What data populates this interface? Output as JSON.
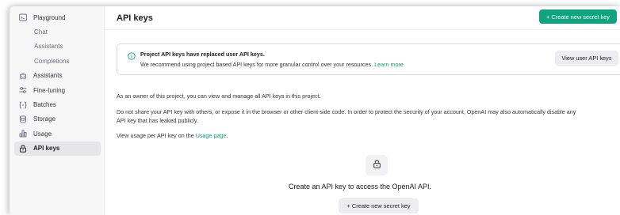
{
  "sidebar": {
    "items": [
      {
        "label": "Playground",
        "icon": "terminal-icon",
        "sub": false,
        "active": false
      },
      {
        "label": "Chat",
        "sub": true,
        "active": false
      },
      {
        "label": "Assistants",
        "sub": true,
        "active": false
      },
      {
        "label": "Completions",
        "sub": true,
        "active": false
      },
      {
        "label": "Assistants",
        "icon": "robot-icon",
        "sub": false,
        "active": false
      },
      {
        "label": "Fine-tuning",
        "icon": "sliders-icon",
        "sub": false,
        "active": false
      },
      {
        "label": "Batches",
        "icon": "braces-icon",
        "sub": false,
        "active": false
      },
      {
        "label": "Storage",
        "icon": "database-icon",
        "sub": false,
        "active": false
      },
      {
        "label": "Usage",
        "icon": "bar-chart-icon",
        "sub": false,
        "active": false
      },
      {
        "label": "API keys",
        "icon": "lock-icon",
        "sub": false,
        "active": true
      }
    ]
  },
  "header": {
    "title": "API keys",
    "create_button": "+ Create new secret key"
  },
  "banner": {
    "title": "Project API keys have replaced user API keys.",
    "text": "We recommend using project based API keys for more granular control over your resources.",
    "link": "Learn more",
    "button": "View user API keys"
  },
  "content": {
    "p1": "As an owner of this project, you can view and manage all API keys in this project.",
    "p2_line1": "Do not share your API key with others, or expose it in the browser or other client-side code. In order to protect the security of your account, OpenAI may also automatically disable any",
    "p2_line2": "API key that has leaked publicly.",
    "p3_text": "View usage per API key on the",
    "p3_link": "Usage page",
    "p3_end": "."
  },
  "empty_state": {
    "icon": "lock-icon",
    "title": "Create an API key to access the OpenAI API.",
    "button": "+ Create new secret key"
  },
  "colors": {
    "accent": "#10a37f",
    "sidebar_bg": "#f7f7f8",
    "active_item_bg": "#e6e6ea"
  }
}
